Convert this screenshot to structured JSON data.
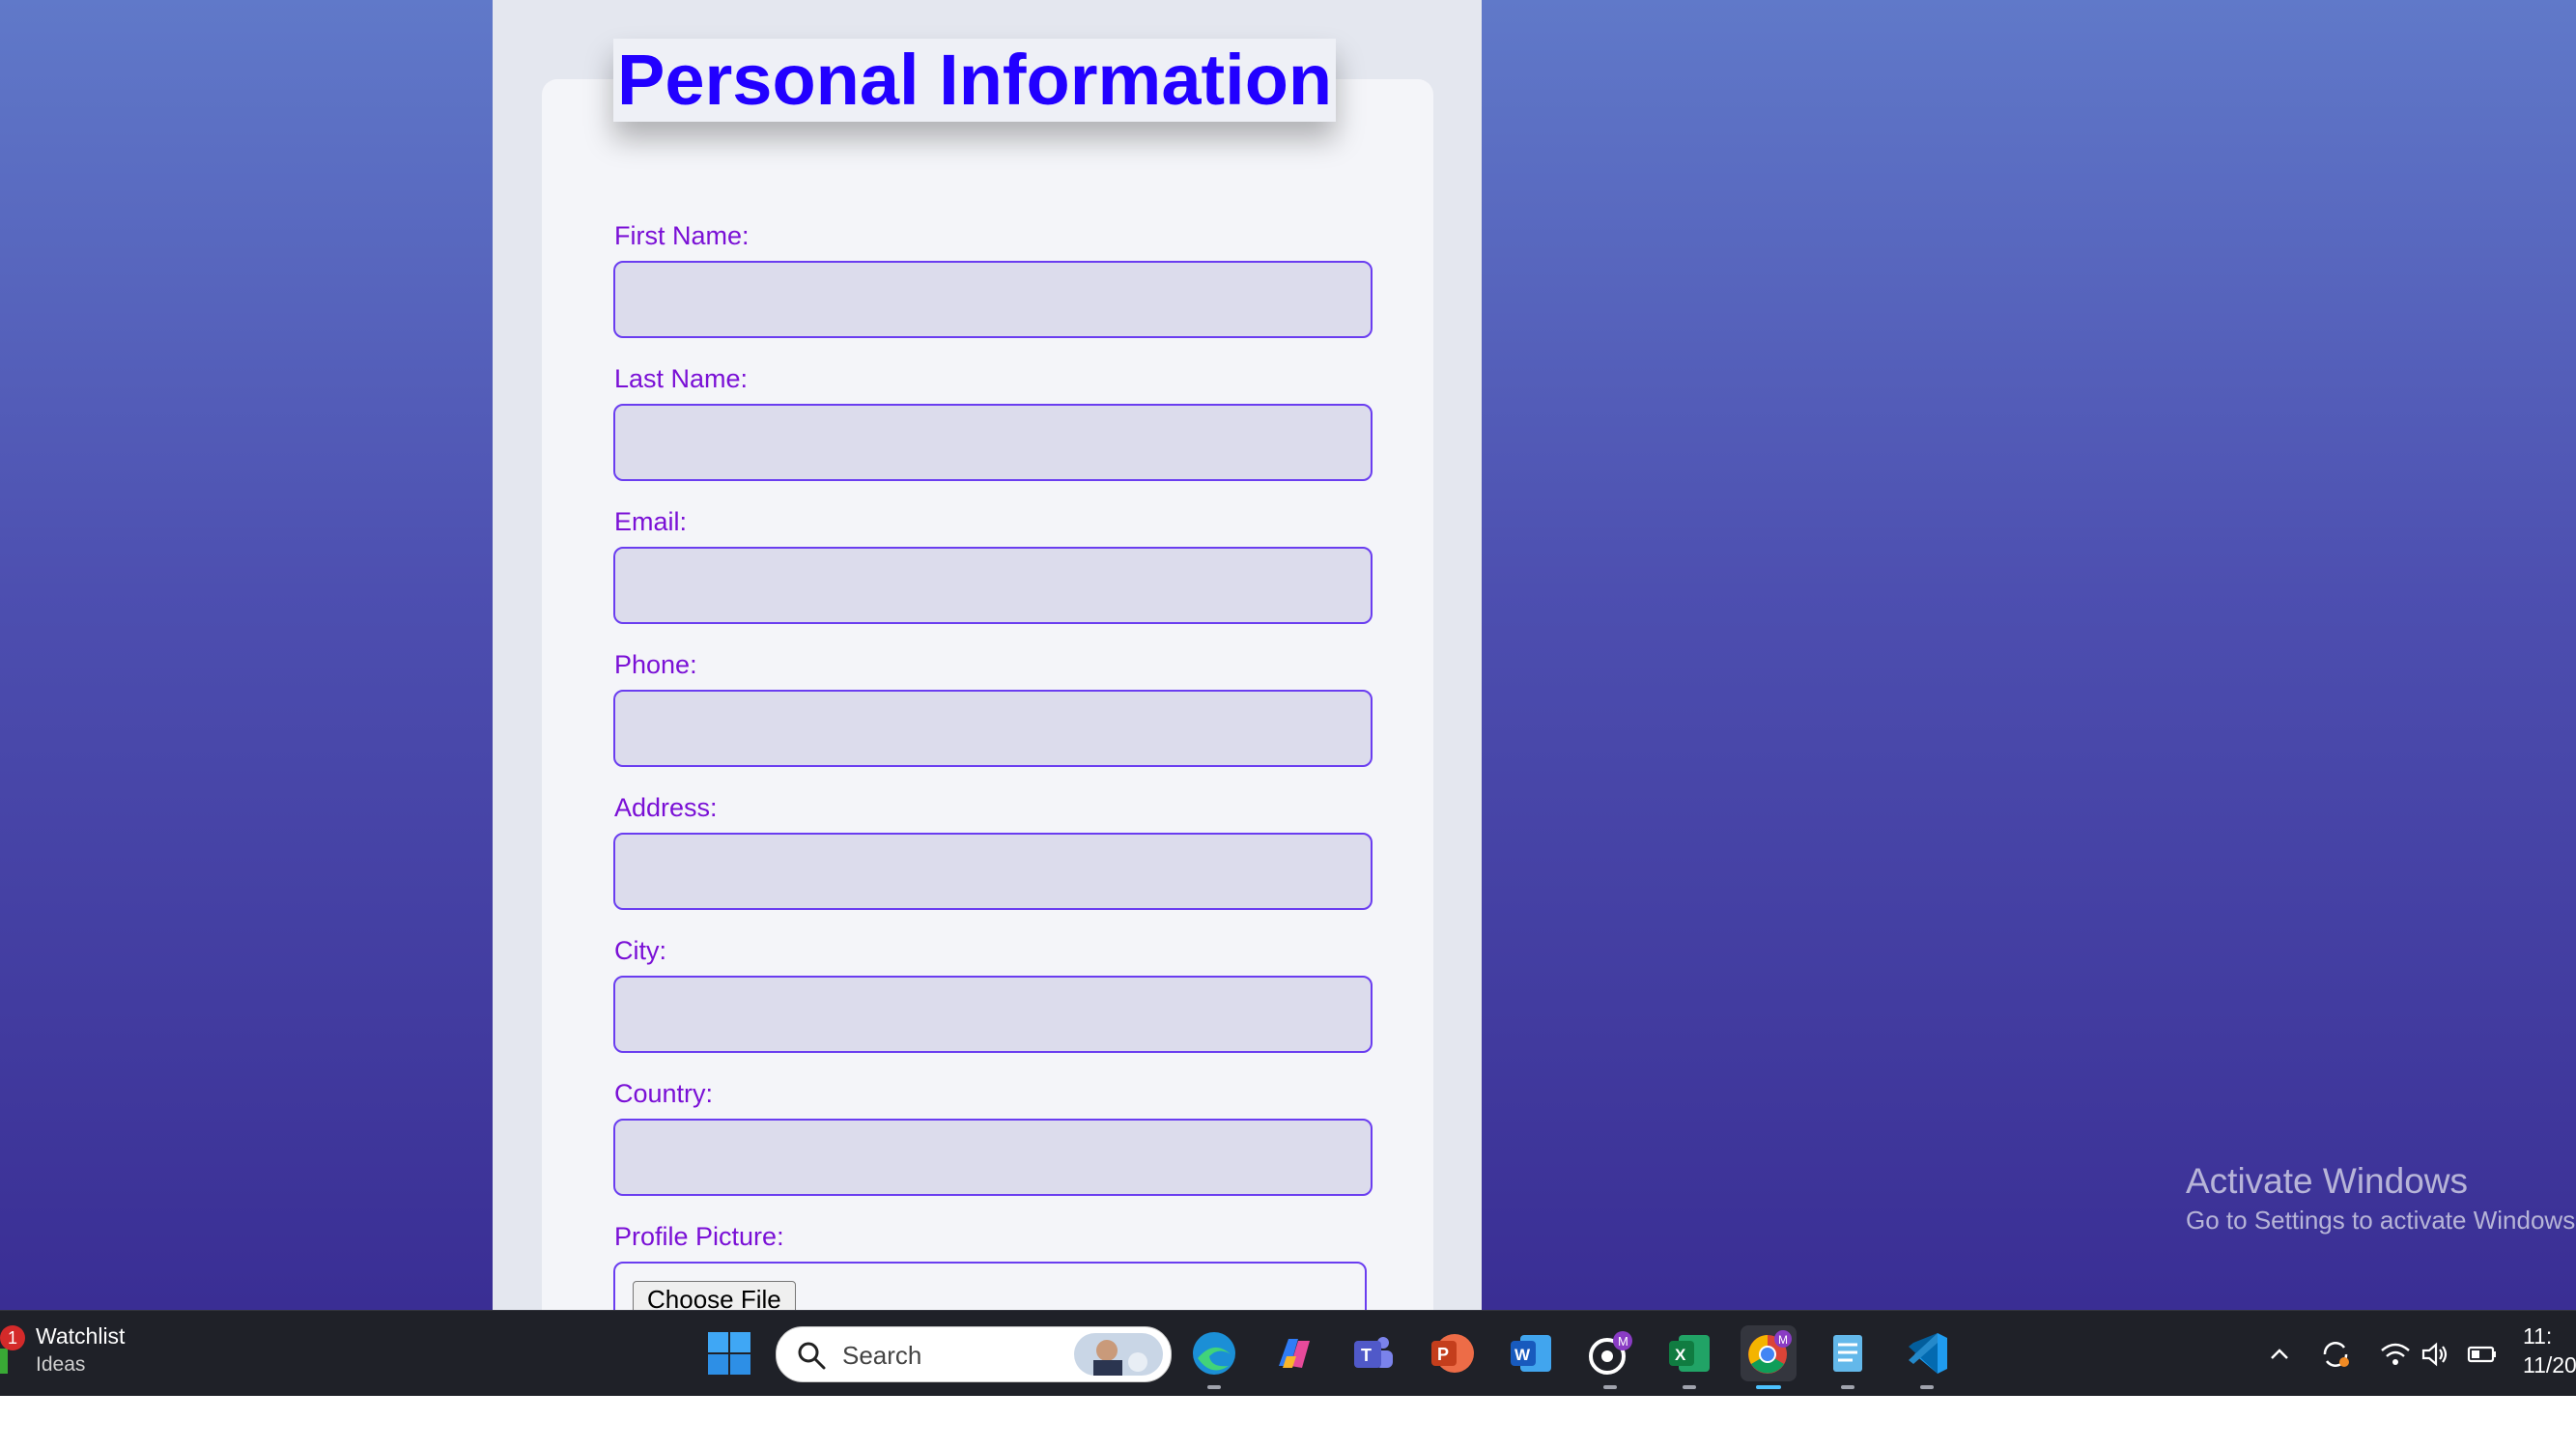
{
  "form": {
    "title": "Personal Information",
    "fields": [
      {
        "label": "First Name:",
        "value": ""
      },
      {
        "label": "Last Name:",
        "value": ""
      },
      {
        "label": "Email:",
        "value": ""
      },
      {
        "label": "Phone:",
        "value": ""
      },
      {
        "label": "Address:",
        "value": ""
      },
      {
        "label": "City:",
        "value": ""
      },
      {
        "label": "Country:",
        "value": ""
      }
    ],
    "profile_picture_label": "Profile Picture:",
    "choose_file_label": "Choose File"
  },
  "watermark": {
    "line1": "Activate Windows",
    "line2": "Go to Settings to activate Windows."
  },
  "taskbar": {
    "widget": {
      "title": "Watchlist",
      "subtitle": "Ideas",
      "badge": "1"
    },
    "search_placeholder": "Search",
    "apps": [
      "start-icon",
      "edge-icon",
      "copilot-icon",
      "teams-icon",
      "powerpoint-icon",
      "word-icon",
      "github-icon",
      "excel-icon",
      "chrome-icon",
      "notepad-icon",
      "vscode-icon"
    ],
    "profile_badge": "M",
    "clock": {
      "time": "11:",
      "date": "11/20"
    }
  },
  "colors": {
    "accent": "#2200ff",
    "label": "#7a10d6",
    "input_border": "#6a3df0",
    "input_bg": "#dcdcec"
  }
}
